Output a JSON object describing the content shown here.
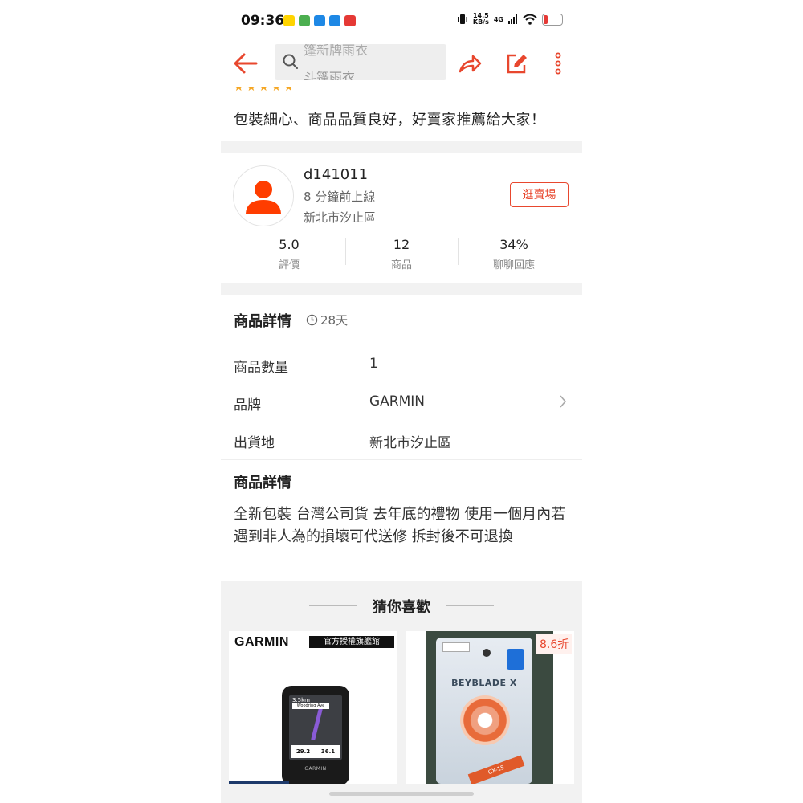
{
  "status_bar": {
    "time": "09:36",
    "net_speed_value": "14.5",
    "net_speed_unit": "KB/s",
    "net_type": "4G",
    "app_colors": [
      "#ffd400",
      "#4caf50",
      "#1e88e5",
      "#1e88e5",
      "#e53935"
    ]
  },
  "top_bar": {
    "search_prev": "篷新牌雨衣",
    "search_current": "斗篷雨衣",
    "accent": "#e8472e"
  },
  "review": {
    "stars": 5,
    "text": "包裝細心、商品品質良好，好賣家推薦給大家！"
  },
  "seller": {
    "name": "d141011",
    "online": "8 分鐘前上線",
    "location": "新北市汐止區",
    "visit_label": "逛賣場",
    "stats": [
      {
        "value": "5.0",
        "label": "評價"
      },
      {
        "value": "12",
        "label": "商品"
      },
      {
        "value": "34%",
        "label": "聊聊回應"
      }
    ]
  },
  "details": {
    "title": "商品詳情",
    "age": "28天",
    "rows": [
      {
        "label": "商品數量",
        "value": "1"
      },
      {
        "label": "品牌",
        "value": "GARMIN"
      },
      {
        "label": "出貨地",
        "value": "新北市汐止區"
      }
    ]
  },
  "description": {
    "title": "商品詳情",
    "body": "全新包裝 台灣公司貨 去年底的禮物 使用一個月內若遇到非人為的損壞可代送修 拆封後不可退換"
  },
  "recommendations": {
    "title": "猜你喜歡",
    "cards": [
      {
        "brand": "GARMIN",
        "tag": "官方授權旗艦館",
        "screen_distance": "3.5km",
        "screen_street": "Woodring Ave",
        "screen_stat_1": "29.2",
        "screen_stat_2": "36.1",
        "device_brand": "GARMIN"
      },
      {
        "discount": "8.6折",
        "logo": "BEYBLADE X",
        "strip": "CX-15"
      }
    ]
  }
}
